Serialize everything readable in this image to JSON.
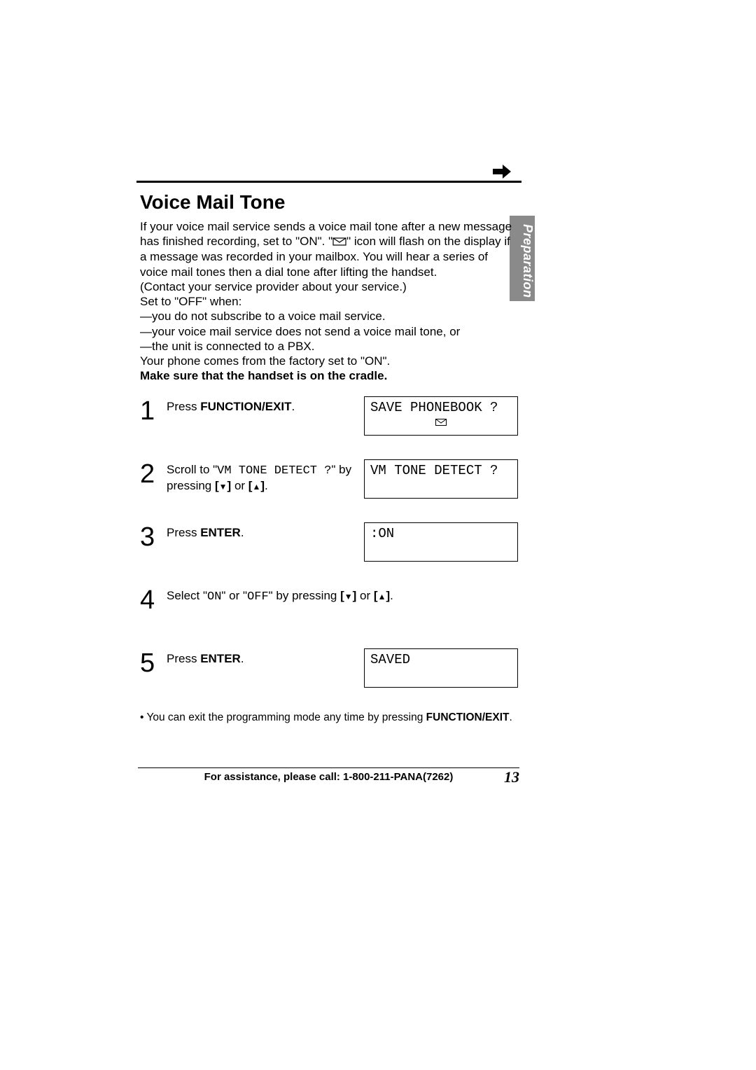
{
  "tab": "Preparation",
  "title": "Voice Mail Tone",
  "intro": {
    "p1a": "If your voice mail service sends a voice mail tone after a new message has finished recording, set to \"ON\". \"",
    "p1b": "\" icon will flash on the display if a message was recorded in your mailbox. You will hear a series of voice mail tones then a dial tone after lifting the handset.",
    "p2": "(Contact your service provider about your service.)",
    "p3": "Set to \"OFF\" when:",
    "p4": "—you do not subscribe to a voice mail service.",
    "p5": "—your voice mail service does not send a voice mail tone, or",
    "p6": "—the unit is connected to a PBX.",
    "p7": "Your phone comes from the factory set to \"ON\".",
    "bold_note": "Make sure that the handset is on the cradle."
  },
  "steps": [
    {
      "num": "1",
      "pre": "Press ",
      "key": "FUNCTION/EXIT",
      "post": ".",
      "lcd": "SAVE PHONEBOOK ?",
      "has_mail_icon": true
    },
    {
      "num": "2",
      "pre": "Scroll to \"",
      "mono": "VM TONE DETECT ?",
      "mid": "\" by pressing ",
      "keys": "[▼] or [▲]",
      "post": ".",
      "lcd": "VM TONE DETECT ?"
    },
    {
      "num": "3",
      "pre": "Press ",
      "key": "ENTER",
      "post": ".",
      "lcd": ":ON"
    },
    {
      "num": "4",
      "pre": "Select \"",
      "mono1": "ON",
      "mid1": "\" or \"",
      "mono2": "OFF",
      "mid2": "\" by pressing ",
      "keys": "[▼]",
      "post1": " or ",
      "keys2": "[▲]",
      "post2": "."
    },
    {
      "num": "5",
      "pre": "Press ",
      "key": "ENTER",
      "post": ".",
      "lcd": "SAVED"
    }
  ],
  "exit_note": "• You can exit the programming mode any time by pressing ",
  "exit_key": "FUNCTION/EXIT",
  "exit_post": ".",
  "footer": "For assistance, please call: 1-800-211-PANA(7262)",
  "page_num": "13"
}
